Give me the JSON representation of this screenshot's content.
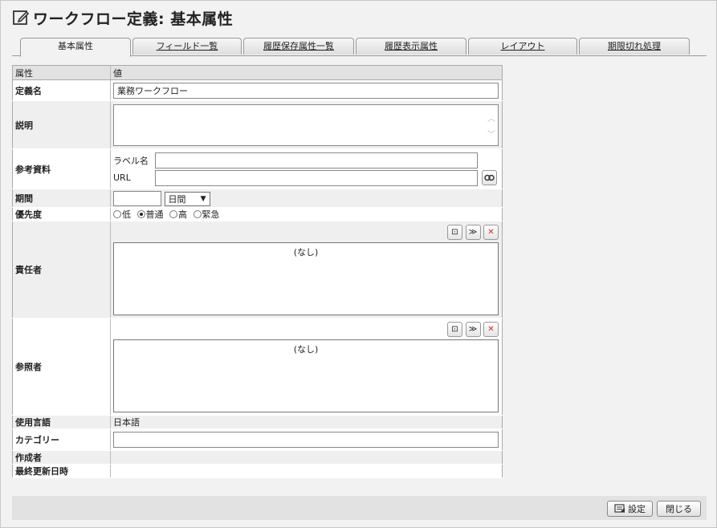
{
  "page": {
    "title": "ワークフロー定義: 基本属性",
    "title_icon": "edit-icon"
  },
  "tabs": [
    {
      "label": "基本属性",
      "active": true
    },
    {
      "label": "フィールド一覧"
    },
    {
      "label": "履歴保存属性一覧"
    },
    {
      "label": "履歴表示属性"
    },
    {
      "label": "レイアウト"
    },
    {
      "label": "期限切れ処理"
    }
  ],
  "table": {
    "header": {
      "col1": "属性",
      "col2": "値"
    },
    "rows": {
      "name": {
        "label": "定義名",
        "value": "業務ワークフロー"
      },
      "description": {
        "label": "説明",
        "value": ""
      },
      "reference": {
        "label": "参考資料",
        "label_name_caption": "ラベル名",
        "url_caption": "URL",
        "label_name_value": "",
        "url_value": ""
      },
      "period": {
        "label": "期間",
        "value": "",
        "unit": "日間"
      },
      "priority": {
        "label": "優先度",
        "options": [
          "低",
          "普通",
          "高",
          "緊急"
        ],
        "selected": "普通"
      },
      "responsible": {
        "label": "責任者",
        "empty_text": "(なし)"
      },
      "reference_users": {
        "label": "参照者",
        "empty_text": "(なし)"
      },
      "language": {
        "label": "使用言語",
        "value": "日本語"
      },
      "category": {
        "label": "カテゴリー",
        "value": ""
      },
      "creator": {
        "label": "作成者",
        "value": ""
      },
      "last_updated": {
        "label": "最終更新日時",
        "value": ""
      }
    }
  },
  "footer": {
    "settings_label": "設定",
    "close_label": "閉じる"
  }
}
